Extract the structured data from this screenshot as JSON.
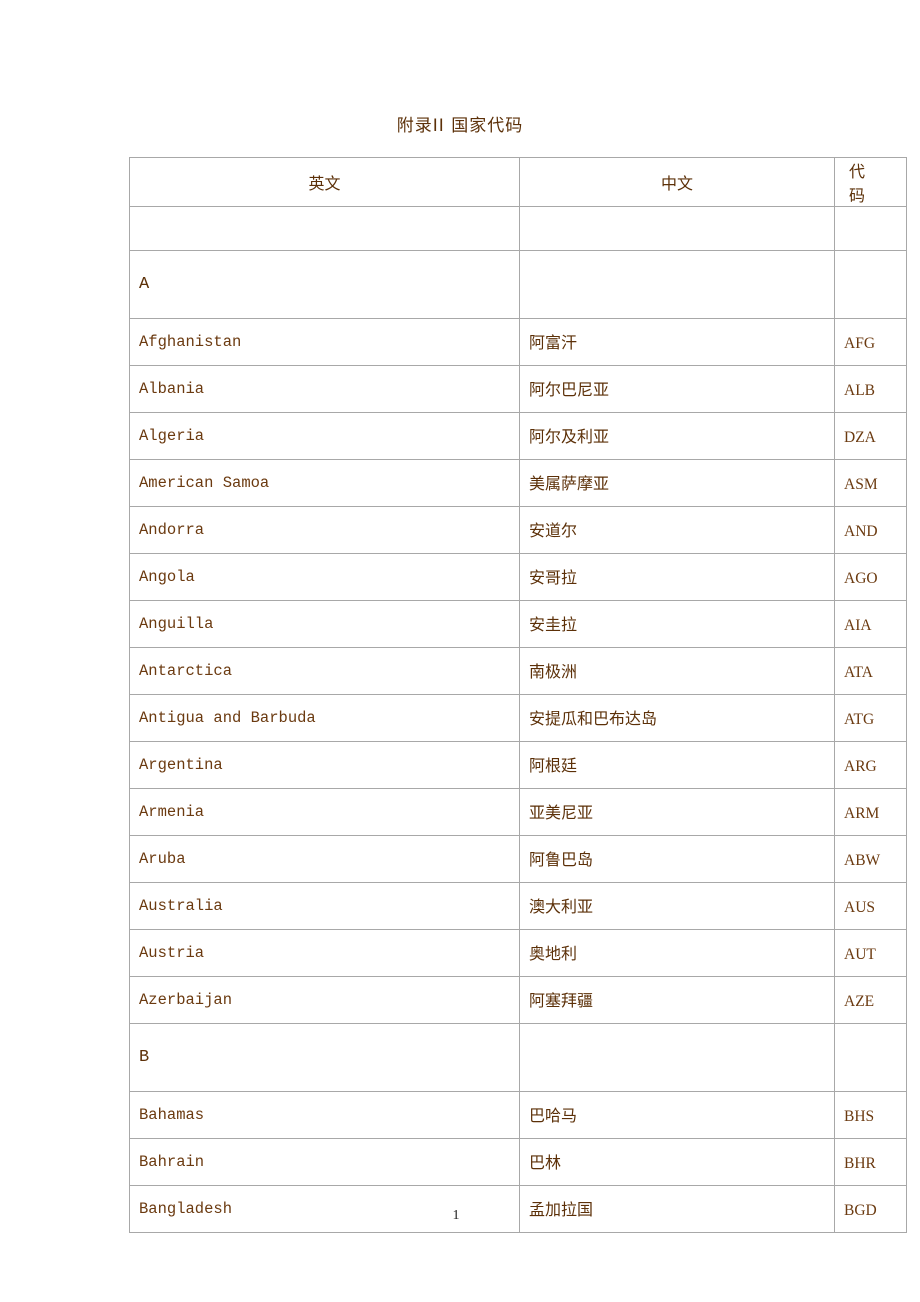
{
  "document": {
    "title": "附录II  国家代码",
    "page_number": "1"
  },
  "table": {
    "headers": {
      "english": "英文",
      "chinese": "中文",
      "code": "代 码"
    },
    "sections": [
      {
        "letter": "A",
        "rows": [
          {
            "en": "Afghanistan",
            "zh": "阿富汗",
            "code": "AFG"
          },
          {
            "en": "Albania",
            "zh": "阿尔巴尼亚",
            "code": "ALB"
          },
          {
            "en": "Algeria",
            "zh": "阿尔及利亚",
            "code": "DZA"
          },
          {
            "en": "American Samoa",
            "zh": "美属萨摩亚",
            "code": "ASM"
          },
          {
            "en": "Andorra",
            "zh": "安道尔",
            "code": "AND"
          },
          {
            "en": "Angola",
            "zh": "安哥拉",
            "code": "AGO"
          },
          {
            "en": "Anguilla",
            "zh": "安圭拉",
            "code": "AIA"
          },
          {
            "en": "Antarctica",
            "zh": "南极洲",
            "code": "ATA"
          },
          {
            "en": "Antigua and Barbuda",
            "zh": "安提瓜和巴布达岛",
            "code": "ATG"
          },
          {
            "en": "Argentina",
            "zh": "阿根廷",
            "code": "ARG"
          },
          {
            "en": "Armenia",
            "zh": "亚美尼亚",
            "code": "ARM"
          },
          {
            "en": "Aruba",
            "zh": "阿鲁巴岛",
            "code": "ABW"
          },
          {
            "en": "Australia",
            "zh": "澳大利亚",
            "code": "AUS"
          },
          {
            "en": "Austria",
            "zh": "奥地利",
            "code": "AUT"
          },
          {
            "en": "Azerbaijan",
            "zh": "阿塞拜疆",
            "code": "AZE"
          }
        ]
      },
      {
        "letter": "B",
        "rows": [
          {
            "en": "Bahamas",
            "zh": "巴哈马",
            "code": "BHS"
          },
          {
            "en": "Bahrain",
            "zh": "巴林",
            "code": "BHR"
          },
          {
            "en": "Bangladesh",
            "zh": "孟加拉国",
            "code": "BGD"
          }
        ]
      }
    ]
  }
}
